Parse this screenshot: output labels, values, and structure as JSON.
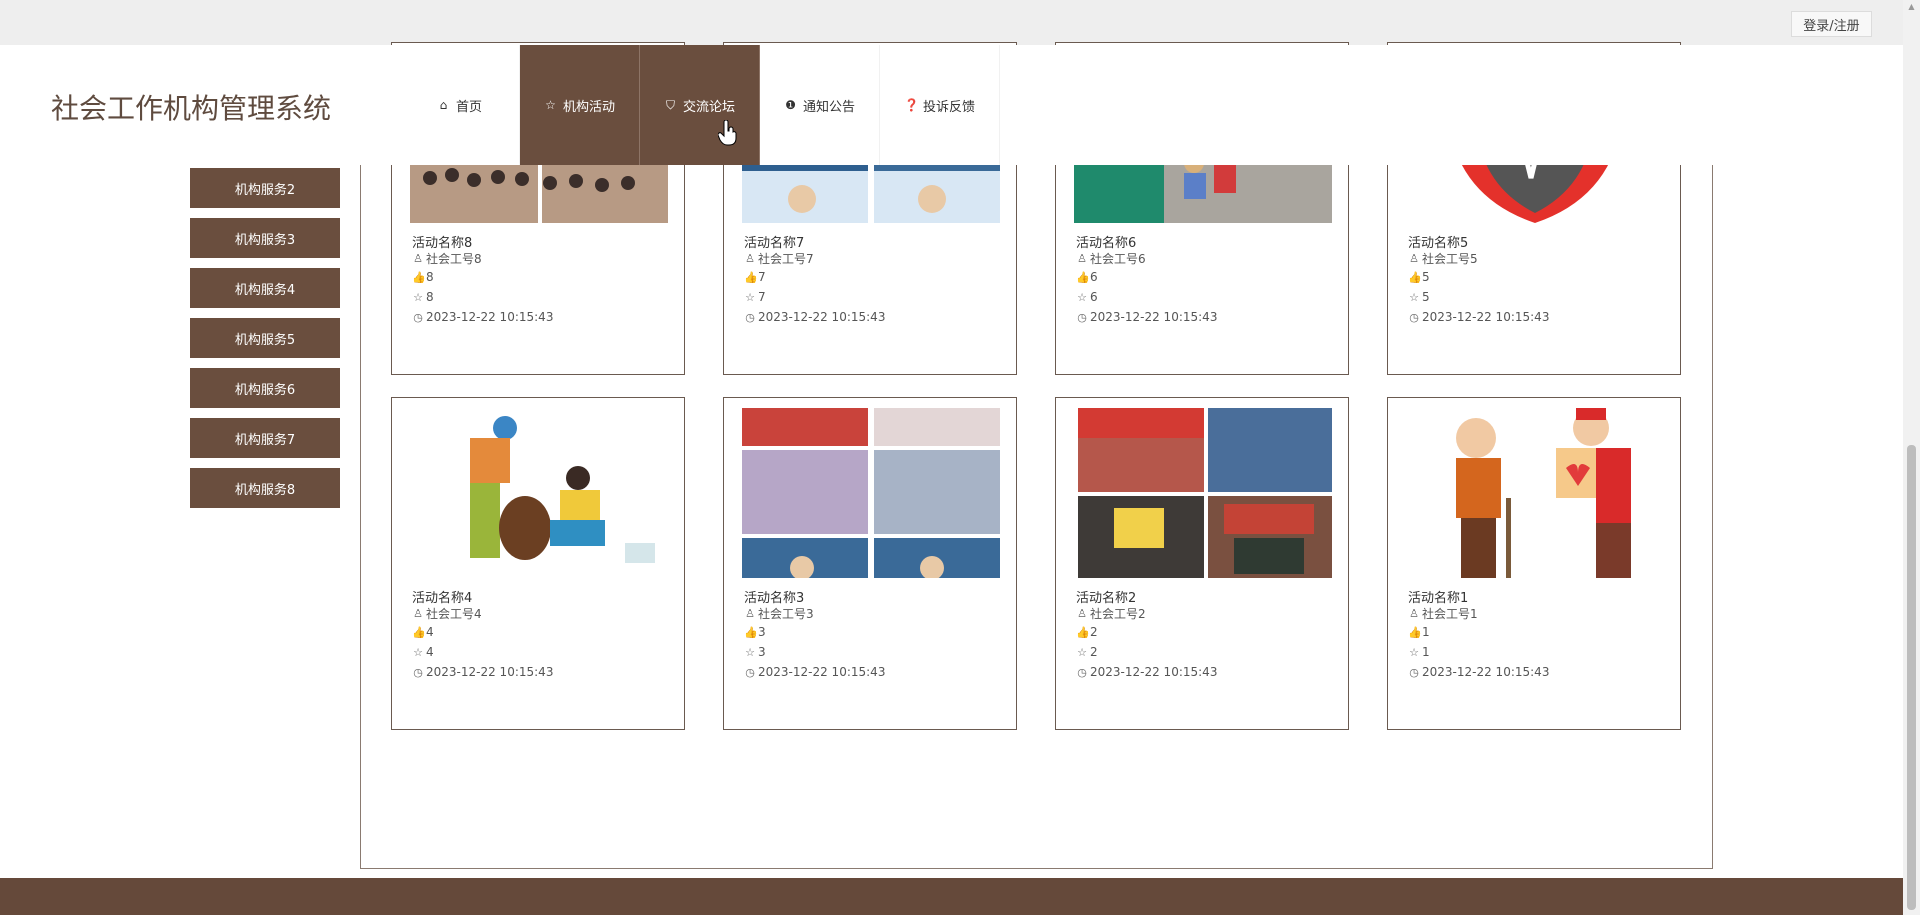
{
  "topbar": {
    "login_label": "登录/注册"
  },
  "header": {
    "title": "社会工作机构管理系统",
    "nav": [
      {
        "icon": "home-icon",
        "glyph": "⌂",
        "label": "首页",
        "active": false
      },
      {
        "icon": "star-icon",
        "glyph": "☆",
        "label": "机构活动",
        "active": true
      },
      {
        "icon": "bag-icon",
        "glyph": "⛉",
        "label": "交流论坛",
        "active": true
      },
      {
        "icon": "info-icon",
        "glyph": "❶",
        "label": "通知公告",
        "active": false
      },
      {
        "icon": "question-icon",
        "glyph": "❓",
        "label": "投诉反馈",
        "active": false
      }
    ]
  },
  "sidebar": {
    "items": [
      {
        "label": "机构服务2"
      },
      {
        "label": "机构服务3"
      },
      {
        "label": "机构服务4"
      },
      {
        "label": "机构服务5"
      },
      {
        "label": "机构服务6"
      },
      {
        "label": "机构服务7"
      },
      {
        "label": "机构服务8"
      }
    ]
  },
  "activities": [
    {
      "name": "活动名称8",
      "author": "社会工号8",
      "likes": "8",
      "favorites": "8",
      "time": "2023-12-22 10:15:43"
    },
    {
      "name": "活动名称7",
      "author": "社会工号7",
      "likes": "7",
      "favorites": "7",
      "time": "2023-12-22 10:15:43"
    },
    {
      "name": "活动名称6",
      "author": "社会工号6",
      "likes": "6",
      "favorites": "6",
      "time": "2023-12-22 10:15:43"
    },
    {
      "name": "活动名称5",
      "author": "社会工号5",
      "likes": "5",
      "favorites": "5",
      "time": "2023-12-22 10:15:43"
    },
    {
      "name": "活动名称4",
      "author": "社会工号4",
      "likes": "4",
      "favorites": "4",
      "time": "2023-12-22 10:15:43"
    },
    {
      "name": "活动名称3",
      "author": "社会工号3",
      "likes": "3",
      "favorites": "3",
      "time": "2023-12-22 10:15:43"
    },
    {
      "name": "活动名称2",
      "author": "社会工号2",
      "likes": "2",
      "favorites": "2",
      "time": "2023-12-22 10:15:43"
    },
    {
      "name": "活动名称1",
      "author": "社会工号1",
      "likes": "1",
      "favorites": "1",
      "time": "2023-12-22 10:15:43"
    }
  ],
  "colors": {
    "brand": "#6a4e3e",
    "footer": "#65493a",
    "topbar": "#eeeeee"
  }
}
